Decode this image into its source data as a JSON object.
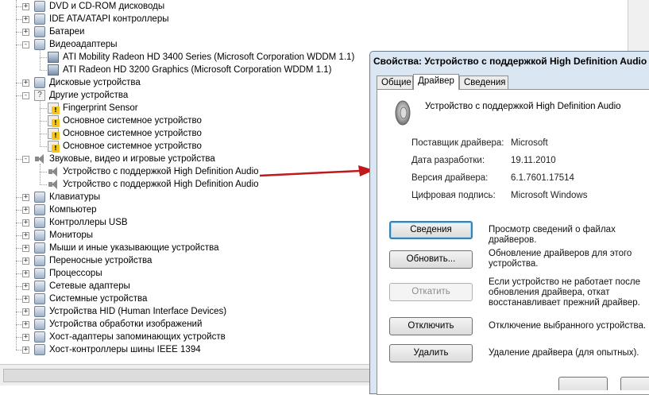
{
  "tree": {
    "rows": [
      {
        "label": "DVD и CD-ROM дисководы",
        "level": 0,
        "expander": "+",
        "icon": "dvd-drive-icon"
      },
      {
        "label": "IDE ATA/ATAPI контроллеры",
        "level": 0,
        "expander": "+",
        "icon": "ide-controller-icon"
      },
      {
        "label": "Батареи",
        "level": 0,
        "expander": "+",
        "icon": "battery-icon"
      },
      {
        "label": "Видеоадаптеры",
        "level": 0,
        "expander": "-",
        "icon": "display-adapter-icon"
      },
      {
        "label": "ATI Mobility Radeon HD 3400 Series (Microsoft Corporation WDDM 1.1)",
        "level": 1,
        "icon": "display-adapter-icon"
      },
      {
        "label": "ATI Radeon HD 3200 Graphics (Microsoft Corporation WDDM 1.1)",
        "level": 1,
        "icon": "display-adapter-icon"
      },
      {
        "label": "Дисковые устройства",
        "level": 0,
        "expander": "+",
        "icon": "disk-drive-icon"
      },
      {
        "label": "Другие устройства",
        "level": 0,
        "expander": "-",
        "icon": "unknown-device-icon"
      },
      {
        "label": "Fingerprint Sensor",
        "level": 1,
        "icon": "warning-device-icon"
      },
      {
        "label": "Основное системное устройство",
        "level": 1,
        "icon": "warning-device-icon"
      },
      {
        "label": "Основное системное устройство",
        "level": 1,
        "icon": "warning-device-icon"
      },
      {
        "label": "Основное системное устройство",
        "level": 1,
        "icon": "warning-device-icon"
      },
      {
        "label": "Звуковые, видео и игровые устройства",
        "level": 0,
        "expander": "-",
        "icon": "speaker-icon"
      },
      {
        "label": "Устройство с поддержкой High Definition Audio",
        "level": 1,
        "icon": "speaker-icon"
      },
      {
        "label": "Устройство с поддержкой High Definition Audio",
        "level": 1,
        "icon": "speaker-icon"
      },
      {
        "label": "Клавиатуры",
        "level": 0,
        "expander": "+",
        "icon": "keyboard-icon"
      },
      {
        "label": "Компьютер",
        "level": 0,
        "expander": "+",
        "icon": "computer-icon"
      },
      {
        "label": "Контроллеры USB",
        "level": 0,
        "expander": "+",
        "icon": "usb-icon"
      },
      {
        "label": "Мониторы",
        "level": 0,
        "expander": "+",
        "icon": "monitor-icon"
      },
      {
        "label": "Мыши и иные указывающие устройства",
        "level": 0,
        "expander": "+",
        "icon": "mouse-icon"
      },
      {
        "label": "Переносные устройства",
        "level": 0,
        "expander": "+",
        "icon": "portable-device-icon"
      },
      {
        "label": "Процессоры",
        "level": 0,
        "expander": "+",
        "icon": "processor-icon"
      },
      {
        "label": "Сетевые адаптеры",
        "level": 0,
        "expander": "+",
        "icon": "network-adapter-icon"
      },
      {
        "label": "Системные устройства",
        "level": 0,
        "expander": "+",
        "icon": "system-device-icon"
      },
      {
        "label": "Устройства HID (Human Interface Devices)",
        "level": 0,
        "expander": "+",
        "icon": "hid-icon"
      },
      {
        "label": "Устройства обработки изображений",
        "level": 0,
        "expander": "+",
        "icon": "camera-icon"
      },
      {
        "label": "Хост-адаптеры запоминающих устройств",
        "level": 0,
        "expander": "+",
        "icon": "storage-adapter-icon"
      },
      {
        "label": "Хост-контроллеры шины IEEE 1394",
        "level": 0,
        "expander": "+",
        "icon": "ieee1394-icon"
      }
    ]
  },
  "dialog": {
    "title": "Свойства: Устройство с поддержкой High Definition Audio",
    "tabs": [
      {
        "label": "Общие",
        "active": false
      },
      {
        "label": "Драйвер",
        "active": true
      },
      {
        "label": "Сведения",
        "active": false
      }
    ],
    "device_name": "Устройство с поддержкой High Definition Audio",
    "info": [
      {
        "label": "Поставщик драйвера:",
        "value": "Microsoft"
      },
      {
        "label": "Дата разработки:",
        "value": "19.11.2010"
      },
      {
        "label": "Версия драйвера:",
        "value": "6.1.7601.17514"
      },
      {
        "label": "Цифровая подпись:",
        "value": "Microsoft Windows"
      }
    ],
    "actions": [
      {
        "button": "Сведения",
        "description": "Просмотр сведений о файлах драйверов.",
        "state": "focused"
      },
      {
        "button": "Обновить...",
        "description": "Обновление драйверов для этого устройства.",
        "state": "normal"
      },
      {
        "button": "Откатить",
        "description": "Если устройство не работает после обновления драйвера, откат восстанавливает прежний драйвер.",
        "state": "disabled"
      },
      {
        "button": "Отключить",
        "description": "Отключение выбранного устройства.",
        "state": "normal"
      },
      {
        "button": "Удалить",
        "description": "Удаление драйвера (для опытных).",
        "state": "normal"
      }
    ]
  },
  "colors": {
    "dialog_bg": "#dbe6f3",
    "arrow": "#c0191c",
    "focus_border": "#3c7fb1"
  }
}
